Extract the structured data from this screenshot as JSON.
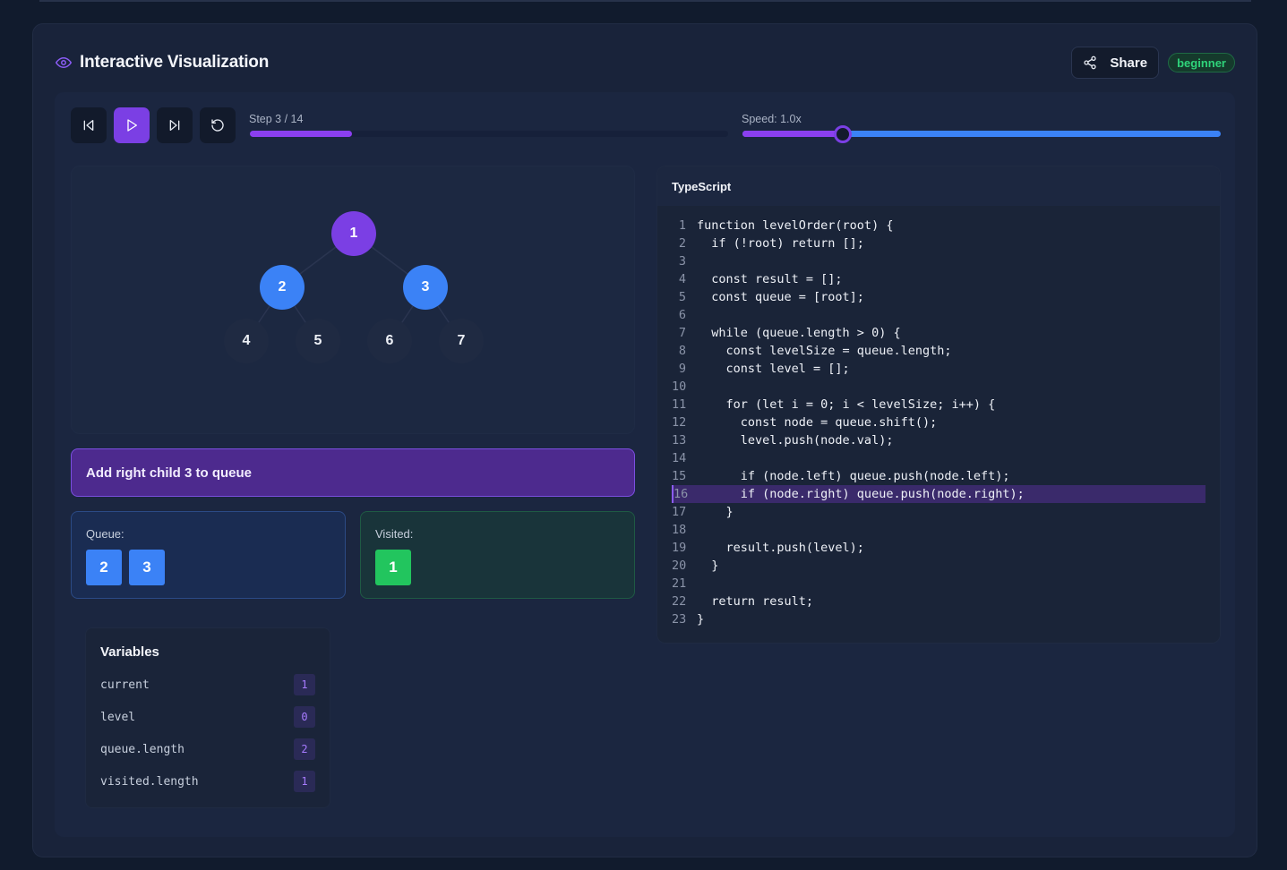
{
  "header": {
    "title": "Interactive Visualization",
    "share_label": "Share",
    "badge": "beginner"
  },
  "controls": {
    "step_label": "Step 3 / 14",
    "step_current": 3,
    "step_total": 14,
    "speed_label": "Speed: 1.0x",
    "speed_fraction": 0.21
  },
  "tree": {
    "nodes": [
      {
        "value": "1",
        "state": "visited"
      },
      {
        "value": "2",
        "state": "queued"
      },
      {
        "value": "3",
        "state": "queued"
      },
      {
        "value": "4",
        "state": "unvisited"
      },
      {
        "value": "5",
        "state": "unvisited"
      },
      {
        "value": "6",
        "state": "unvisited"
      },
      {
        "value": "7",
        "state": "unvisited"
      }
    ]
  },
  "step_message": "Add right child 3 to queue",
  "queue": {
    "title": "Queue:",
    "items": [
      "2",
      "3"
    ]
  },
  "visited": {
    "title": "Visited:",
    "items": [
      "1"
    ]
  },
  "variables": {
    "title": "Variables",
    "items": [
      {
        "name": "current",
        "value": "1"
      },
      {
        "name": "level",
        "value": "0"
      },
      {
        "name": "queue.length",
        "value": "2"
      },
      {
        "name": "visited.length",
        "value": "1"
      }
    ]
  },
  "code": {
    "language": "TypeScript",
    "highlight_line": 16,
    "lines": [
      "function levelOrder(root) {",
      "  if (!root) return [];",
      "",
      "  const result = [];",
      "  const queue = [root];",
      "",
      "  while (queue.length > 0) {",
      "    const levelSize = queue.length;",
      "    const level = [];",
      "",
      "    for (let i = 0; i < levelSize; i++) {",
      "      const node = queue.shift();",
      "      level.push(node.val);",
      "",
      "      if (node.left) queue.push(node.left);",
      "      if (node.right) queue.push(node.right);",
      "    }",
      "",
      "    result.push(level);",
      "  }",
      "",
      "  return result;",
      "}"
    ]
  },
  "colors": {
    "accent": "#7b3fe4",
    "queued": "#3b82f6",
    "visited": "#22c55e"
  }
}
